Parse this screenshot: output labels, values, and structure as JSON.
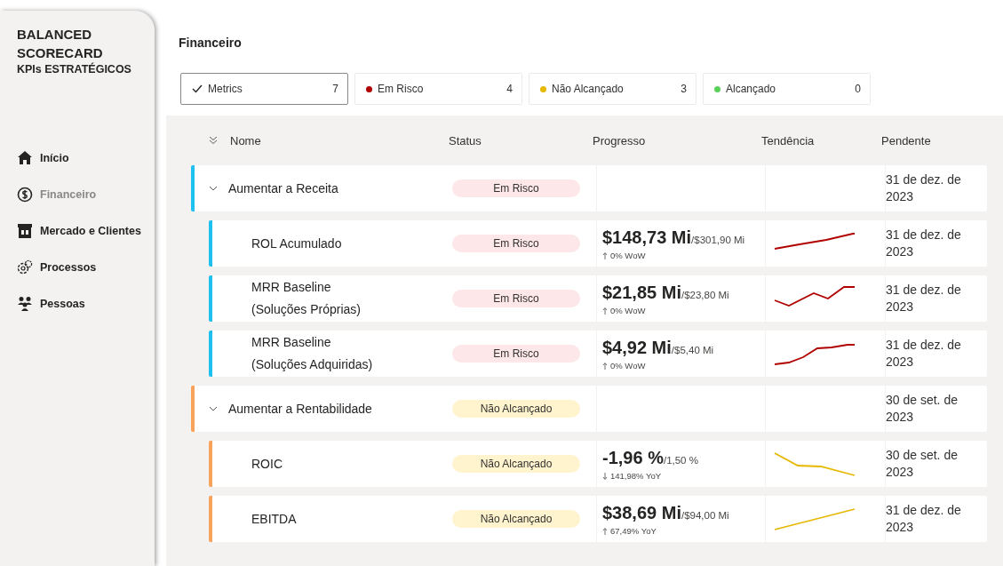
{
  "sidebar": {
    "title": "BALANCED SCORECARD",
    "subtitle": "KPIs ESTRATÉGICOS",
    "items": [
      {
        "label": "Início",
        "selected": false
      },
      {
        "label": "Financeiro",
        "selected": true
      },
      {
        "label": "Mercado e Clientes",
        "selected": false
      },
      {
        "label": "Processos",
        "selected": false
      },
      {
        "label": "Pessoas",
        "selected": false
      }
    ]
  },
  "page_title": "Financeiro",
  "filters": [
    {
      "kind": "all",
      "label": "Metrics",
      "count": "7",
      "selected": true
    },
    {
      "kind": "status",
      "label": "Em Risco",
      "count": "4",
      "selected": false,
      "color": "#b00000"
    },
    {
      "kind": "status",
      "label": "Não Alcançado",
      "count": "3",
      "selected": false,
      "color": "#e6b800"
    },
    {
      "kind": "status",
      "label": "Alcançado",
      "count": "0",
      "selected": false,
      "color": "#5ad25a"
    }
  ],
  "table": {
    "columns": [
      "Nome",
      "Status",
      "Progresso",
      "Tendência",
      "Pendente"
    ],
    "groups": [
      {
        "name": "Aumentar a Receita",
        "color": "#1ec0f0",
        "expanded": true,
        "status": {
          "kind": "at_risk",
          "label": "Em Risco"
        },
        "due": "31 de dez. de 2023",
        "children": [
          {
            "name": "ROL Acumulado",
            "status": {
              "kind": "at_risk",
              "label": "Em Risco"
            },
            "value": "$148,73 Mi",
            "target": "/$301,90 Mi",
            "decreasing": false,
            "change": "0% WoW",
            "due": "31 de dez. de 2023"
          },
          {
            "name": "MRR Baseline (Soluções Próprias)",
            "status": {
              "kind": "at_risk",
              "label": "Em Risco"
            },
            "value": "$21,85 Mi",
            "target": "/$23,80 Mi",
            "decreasing": false,
            "change": "0% WoW",
            "due": "31 de dez. de 2023"
          },
          {
            "name": "MRR Baseline (Soluções Adquiridas)",
            "status": {
              "kind": "at_risk",
              "label": "Em Risco"
            },
            "value": "$4,92 Mi",
            "target": "/$5,40 Mi",
            "decreasing": false,
            "change": "0% WoW",
            "due": "31 de dez. de 2023"
          }
        ]
      },
      {
        "name": "Aumentar a Rentabilidade",
        "color": "#f7a35c",
        "expanded": true,
        "status": {
          "kind": "not_achieved",
          "label": "Não Alcançado"
        },
        "due": "30 de set. de 2023",
        "children": [
          {
            "name": "ROIC",
            "status": {
              "kind": "not_achieved",
              "label": "Não Alcançado"
            },
            "value": "-1,96 %",
            "target": "/1,50 %",
            "decreasing": true,
            "change": "141,98% YoY",
            "due": "30 de set. de 2023"
          },
          {
            "name": "EBITDA",
            "status": {
              "kind": "not_achieved",
              "label": "Não Alcançado"
            },
            "value": "$38,69 Mi",
            "target": "/$94,00 Mi",
            "decreasing": false,
            "change": "67,49% YoY",
            "due": "31 de dez. de 2023"
          }
        ]
      }
    ]
  }
}
